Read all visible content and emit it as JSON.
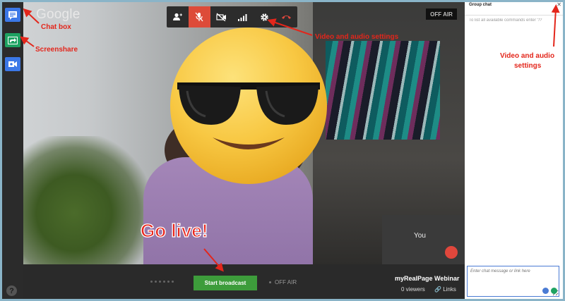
{
  "logo": {
    "text": "Google"
  },
  "status": {
    "top_label": "OFF AIR"
  },
  "toolbar": {
    "icons": [
      "invite-person-icon",
      "mic-muted-icon",
      "camera-off-icon",
      "bandwidth-icon",
      "settings-icon",
      "hang-up-icon"
    ]
  },
  "rail": {
    "icons": [
      "chat-icon",
      "screenshare-icon",
      "record-icon"
    ],
    "help": "?"
  },
  "self_view": {
    "label": "You"
  },
  "bottom_bar": {
    "start_label": "Start broadcast",
    "off_air_label": "OFF AIR",
    "event_title": "myRealPage Webinar",
    "viewers_text": "0 viewers",
    "links_text": "Links"
  },
  "chat": {
    "title": "Group chat",
    "hint": "To list all available commands enter \"/?",
    "placeholder": "Enter chat message or link here"
  },
  "annotations": {
    "chat_box": "Chat box",
    "screenshare": "Screenshare",
    "video_audio_1": "Video and audio settings",
    "video_audio_2_line1": "Video and audio",
    "video_audio_2_line2": "settings",
    "go_live": "Go live!"
  },
  "colors": {
    "accent_red": "#dd4b39",
    "start_green": "#3d9c3b",
    "annotation_red": "#e3261b",
    "rail_blue": "#3b78e7"
  }
}
